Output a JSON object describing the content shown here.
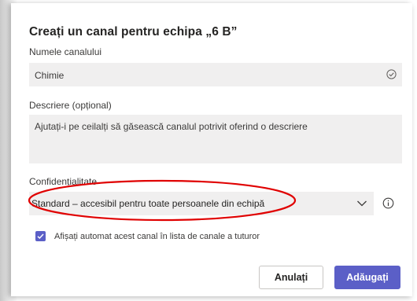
{
  "dialog": {
    "title": "Creați un canal pentru echipa „6 B”",
    "name_label": "Numele canalului",
    "name_value": "Chimie",
    "description_label": "Descriere (opțional)",
    "description_placeholder": "Ajutați-i pe ceilalți să găsească canalul potrivit oferind o descriere",
    "privacy_label": "Confidențialitate",
    "privacy_value": "Standard – accesibil pentru toate persoanele din echipă",
    "auto_show_label": "Afișați automat acest canal în lista de canale a tuturor",
    "auto_show_checked": true,
    "cancel_label": "Anulați",
    "add_label": "Adăugați"
  },
  "colors": {
    "accent": "#5b5fc7",
    "field_bg": "#f0efef",
    "annotation": "#e00000"
  },
  "icons": {
    "name_valid": "check-circle-icon",
    "dropdown": "chevron-down-icon",
    "info": "info-icon",
    "checkbox": "checkmark-icon"
  }
}
